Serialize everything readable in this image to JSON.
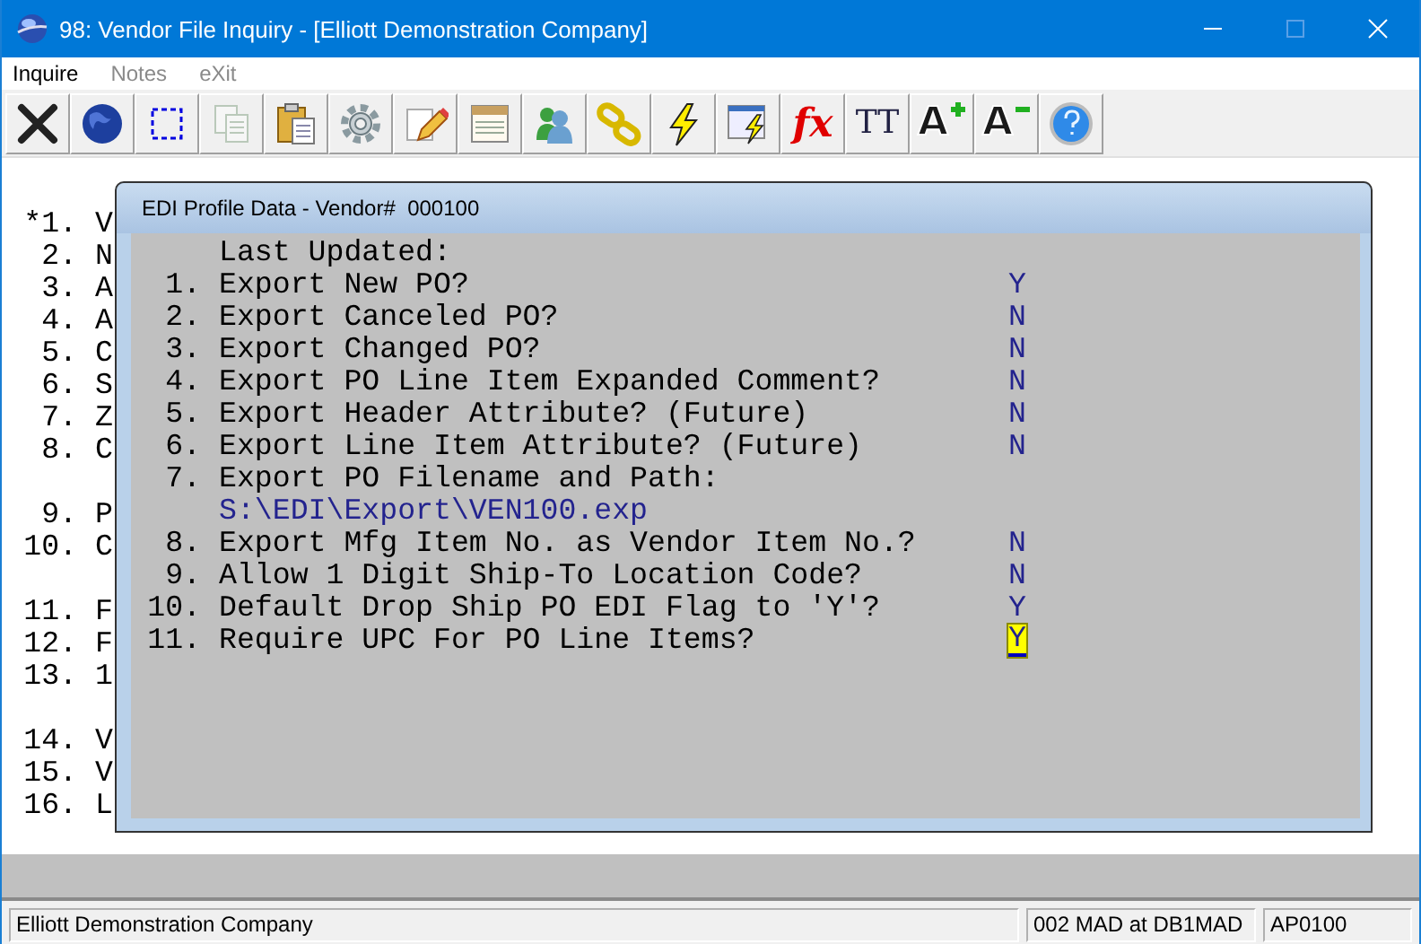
{
  "window": {
    "title": "98: Vendor File Inquiry - [Elliott Demonstration Company]"
  },
  "menu": [
    {
      "label": "Inquire",
      "disabled": false
    },
    {
      "label": "Notes",
      "disabled": true
    },
    {
      "label": "eXit",
      "disabled": true
    }
  ],
  "toolbar": [
    {
      "kind": "close",
      "disabled": false
    },
    {
      "kind": "globe",
      "disabled": false
    },
    {
      "kind": "select",
      "disabled": false
    },
    {
      "kind": "copy",
      "disabled": true
    },
    {
      "kind": "paste",
      "disabled": false
    },
    {
      "kind": "gear",
      "disabled": false
    },
    {
      "kind": "pencil",
      "disabled": false
    },
    {
      "kind": "notepad",
      "disabled": false
    },
    {
      "kind": "users",
      "disabled": false
    },
    {
      "kind": "chain",
      "disabled": false
    },
    {
      "kind": "bolt",
      "disabled": false
    },
    {
      "kind": "windowbolt",
      "disabled": false
    },
    {
      "kind": "fx",
      "label": "fx",
      "disabled": false
    },
    {
      "kind": "tt",
      "label": "TT",
      "disabled": false
    },
    {
      "kind": "fontup",
      "label": "A",
      "disabled": false
    },
    {
      "kind": "fontdown",
      "label": "A",
      "disabled": false
    },
    {
      "kind": "help",
      "disabled": false
    }
  ],
  "background": {
    "groups": [
      [
        {
          "number": "*1.",
          "text": "V"
        },
        {
          "number": "2.",
          "text": "N"
        },
        {
          "number": "3.",
          "text": "A"
        },
        {
          "number": "4.",
          "text": "A"
        },
        {
          "number": "5.",
          "text": "C"
        },
        {
          "number": "6.",
          "text": "S"
        },
        {
          "number": "7.",
          "text": "Z"
        },
        {
          "number": "8.",
          "text": "C"
        }
      ],
      [
        {
          "number": "9.",
          "text": "P"
        },
        {
          "number": "10.",
          "text": "C"
        }
      ],
      [
        {
          "number": "11.",
          "text": "F"
        },
        {
          "number": "12.",
          "text": "F"
        },
        {
          "number": "13.",
          "text": "1"
        }
      ],
      [
        {
          "number": "14.",
          "text": "V"
        },
        {
          "number": "15.",
          "text": "V"
        },
        {
          "number": "16.",
          "text": "L"
        }
      ]
    ]
  },
  "dialog": {
    "title": "EDI Profile Data - Vendor#  000100",
    "rows": [
      {
        "label": "Last Updated:"
      },
      {
        "number": "1.",
        "label": "Export New PO?",
        "value": "Y",
        "focused": false
      },
      {
        "number": "2.",
        "label": "Export Canceled PO?",
        "value": "N",
        "focused": false
      },
      {
        "number": "3.",
        "label": "Export Changed PO?",
        "value": "N",
        "focused": false
      },
      {
        "number": "4.",
        "label": "Export PO Line Item Expanded Comment?",
        "value": "N",
        "focused": false
      },
      {
        "number": "5.",
        "label": "Export Header Attribute? (Future)",
        "value": "N",
        "focused": false
      },
      {
        "number": "6.",
        "label": "Export Line Item Attribute? (Future)",
        "value": "N",
        "focused": false
      },
      {
        "number": "7.",
        "label": "Export PO Filename and Path:",
        "continuation": "S:\\EDI\\Export\\VEN100.exp"
      },
      {
        "number": "8.",
        "label": "Export Mfg Item No. as Vendor Item No.?",
        "value": "N",
        "focused": false
      },
      {
        "number": "9.",
        "label": "Allow 1 Digit Ship-To Location Code?",
        "value": "N",
        "focused": false
      },
      {
        "number": "10.",
        "label": "Default Drop Ship PO EDI Flag to 'Y'?",
        "value": "Y",
        "focused": false
      },
      {
        "number": "11.",
        "label": "Require UPC For PO Line Items?",
        "value": "Y",
        "focused": true
      }
    ]
  },
  "status_bar": {
    "company": "Elliott Demonstration Company",
    "database": "002 MAD at DB1MAD",
    "program": "AP0100"
  }
}
